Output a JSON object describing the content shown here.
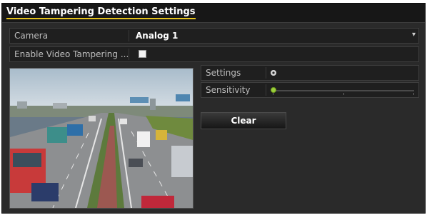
{
  "dialog": {
    "title": "Video Tampering Detection Settings"
  },
  "camera": {
    "label": "Camera",
    "value": "Analog 1"
  },
  "enable": {
    "label": "Enable Video Tampering ...",
    "checked": false
  },
  "settings": {
    "label": "Settings",
    "icon": "gear-icon"
  },
  "sensitivity": {
    "label": "Sensitivity",
    "level": 0
  },
  "clear_button": {
    "label": "Clear"
  },
  "colors": {
    "title_underline": "#e5c21c",
    "slider_knob": "#9ccf3c"
  }
}
